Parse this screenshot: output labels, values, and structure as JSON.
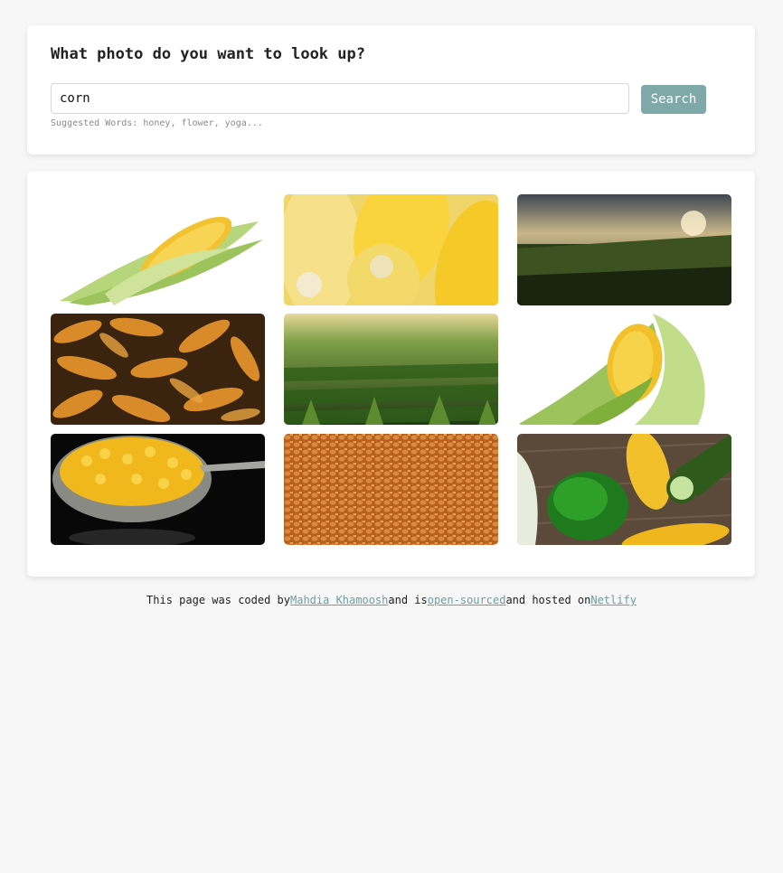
{
  "search": {
    "heading": "What photo do you want to look up?",
    "query": "corn",
    "button_label": "Search",
    "suggestions": "Suggested Words: honey, flower, yoga..."
  },
  "gallery": {
    "photos": [
      {
        "subject": "corn cob with green husk on white background"
      },
      {
        "subject": "close-up of yellow corn cobs"
      },
      {
        "subject": "corn field at sunset"
      },
      {
        "subject": "pile of dried corn cobs"
      },
      {
        "subject": "rows of young corn plants in field"
      },
      {
        "subject": "corn cob with husk on white background"
      },
      {
        "subject": "strainer of corn kernels on black background"
      },
      {
        "subject": "dried corn kernels texture"
      },
      {
        "subject": "corn cobs with green pepper and cucumber on wood"
      }
    ]
  },
  "footer": {
    "prefix": "This page was coded by",
    "author_link": "Mahdia Khamoosh",
    "middle": "and is",
    "source_link": "open-sourced",
    "hosted": "and hosted on",
    "host_link": "Netlify"
  },
  "colors": {
    "page_bg": "#f7f7f7",
    "button": "#7fa8a8",
    "link": "#6b9e9e"
  }
}
